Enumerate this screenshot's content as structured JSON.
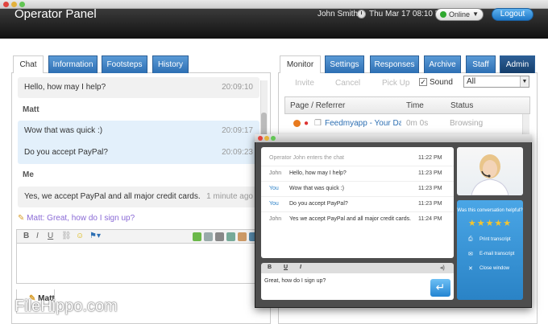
{
  "app": {
    "title": "Operator Panel"
  },
  "header": {
    "user": "John Smith",
    "datetime": "Thu Mar 17 08:10 PM",
    "status": "Online",
    "logout": "Logout"
  },
  "left_tabs": [
    "Chat",
    "Information",
    "Footsteps",
    "History"
  ],
  "chat": {
    "messages": [
      {
        "text": "Hello, how may I help?",
        "time": "20:09:10"
      },
      {
        "sender": "Matt",
        "text": "Wow that was quick :)",
        "time": "20:09:17"
      },
      {
        "text": "Do you accept PayPal?",
        "time": "20:09:23"
      },
      {
        "sender": "Me",
        "text": "Yes, we accept PayPal and all major credit cards.",
        "time": "1 minute ago"
      }
    ],
    "typing": "Matt: Great, how do I sign up?",
    "bottom_tab": "Matt"
  },
  "editor_toolbar": {
    "bold": "B",
    "italic": "I",
    "underline": "U"
  },
  "right_tabs": [
    "Monitor",
    "Settings",
    "Responses",
    "Archive",
    "Staff",
    "Admin"
  ],
  "monitor": {
    "actions": [
      "Invite",
      "Cancel",
      "Pick Up"
    ],
    "sound_label": "Sound",
    "sound_checked": "✓",
    "filter": "All",
    "columns": [
      "Page / Referrer",
      "Time",
      "Status"
    ],
    "rows": [
      {
        "page": "Feedmyapp - Your Daily \\",
        "time": "0m 0s",
        "status": "Browsing"
      }
    ]
  },
  "popup": {
    "system_msg": "Operator John enters the chat",
    "system_time": "11:22 PM",
    "lines": [
      {
        "name": "John",
        "text": "Hello, how may I help?",
        "time": "11:23 PM"
      },
      {
        "name": "You",
        "text": "Wow that was quick :)",
        "time": "11:23 PM"
      },
      {
        "name": "You",
        "text": "Do you accept PayPal?",
        "time": "11:23 PM"
      },
      {
        "name": "John",
        "text": "Yes we accept PayPal and all major credit cards.",
        "time": "11:24 PM"
      }
    ],
    "toolbar": {
      "bold": "B",
      "underline": "U",
      "italic": "I"
    },
    "input_value": "Great, how do I sign up?",
    "helpful_q": "Was this conversation helpful?",
    "stars": "★★★★★",
    "side_actions": [
      "Print transcript",
      "E-mail transcript",
      "Close window"
    ]
  },
  "watermark": "FileHippo.com",
  "colors": {
    "tab_blue": "#2d6fb3",
    "admin_tab": "#1b4f86",
    "side_blue": "#2a83c6",
    "typing_purple": "#8a6ad6"
  }
}
